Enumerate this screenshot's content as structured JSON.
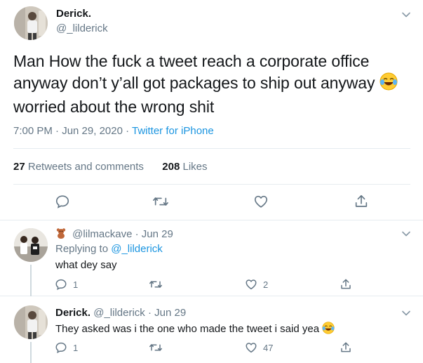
{
  "main": {
    "display_name": "Derick.",
    "handle": "@_lilderick",
    "text": "Man How the fuck a tweet reach a corporate office anyway don’t y’all got packages to ship out anyway",
    "text_end": "worried about the wrong shit",
    "time": "7:00 PM · Jun 29, 2020 · ",
    "source": "Twitter for iPhone",
    "retweets_count": "27",
    "retweets_label": "Retweets and comments",
    "likes_count": "208",
    "likes_label": "Likes"
  },
  "replies": [
    {
      "display_name": "",
      "handle": "@lilmackave",
      "date": "· Jun 29",
      "replying_prefix": "Replying to",
      "replying_handle": "@_lilderick",
      "text": "what dey say",
      "reply_count": "1",
      "retweet_count": "",
      "like_count": "2"
    },
    {
      "display_name": "Derick.",
      "handle": "@_lilderick",
      "date": "· Jun 29",
      "text": "They asked was i the one who made the tweet i said yea",
      "reply_count": "1",
      "retweet_count": "",
      "like_count": "47"
    }
  ],
  "icons": {
    "reply": "comment-bubble-icon",
    "retweet": "retweet-icon",
    "like": "heart-icon",
    "share": "share-icon",
    "more": "chevron-down-icon",
    "emoji": "tears-of-joy-emoji",
    "badge": "teddy-bear-emoji"
  },
  "colors": {
    "link": "#1b95e0",
    "muted": "#657786",
    "text": "#14171a",
    "border": "#e6ecf0"
  }
}
